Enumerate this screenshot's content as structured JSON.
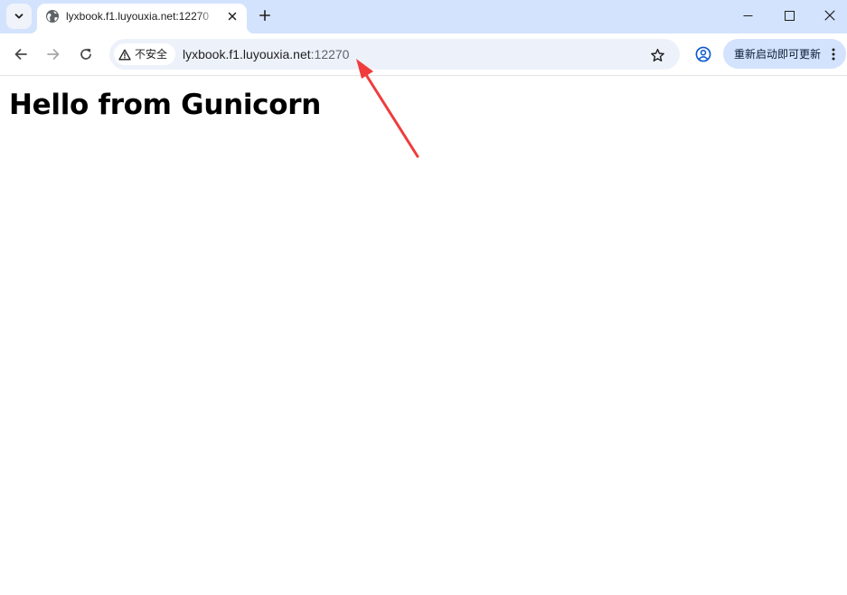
{
  "browser": {
    "tab": {
      "title": "lyxbook.f1.luyouxia.net:12270",
      "favicon": "globe-icon"
    },
    "window_controls": [
      "minimize-icon",
      "maximize-icon",
      "close-icon"
    ],
    "toolbar": {
      "security_label": "不安全",
      "url_host": "lyxbook.f1.luyouxia.net",
      "url_port": ":12270",
      "update_button_label": "重新启动即可更新"
    },
    "colors": {
      "tabstrip": "#d3e3fd",
      "omnibox": "#edf2fa",
      "update_button": "#d3e3fd",
      "profile_icon": "#0b57d0",
      "annotation_arrow": "#f03c3c"
    }
  },
  "page": {
    "heading": "Hello from Gunicorn"
  },
  "annotation": {
    "type": "arrow",
    "points_to": "url_port"
  }
}
